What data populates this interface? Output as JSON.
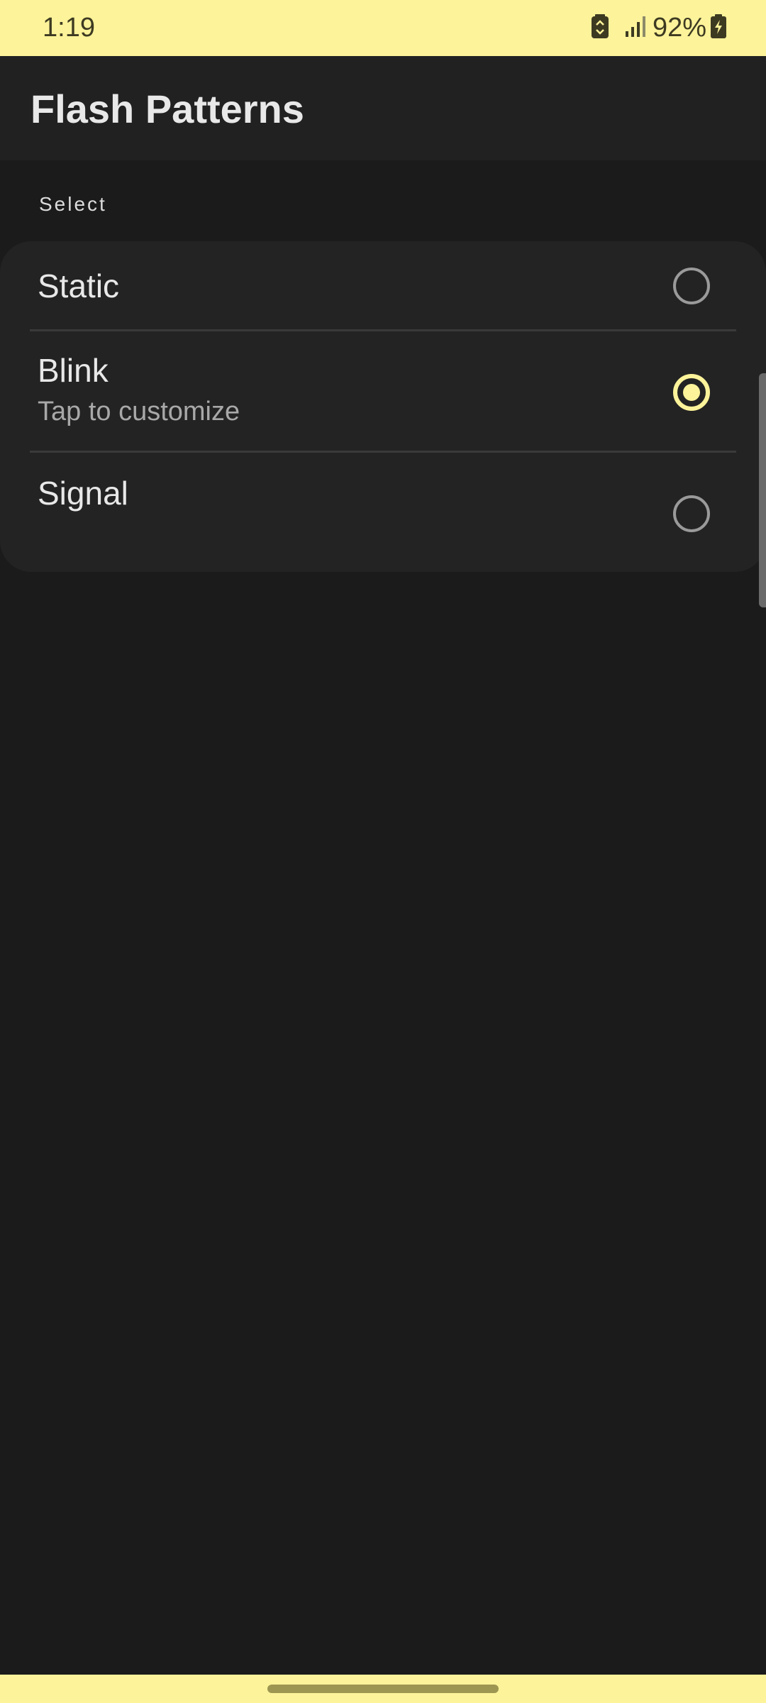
{
  "status_bar": {
    "time": "1:19",
    "battery_percent": "92%",
    "icons": [
      "battery-saver-icon",
      "cell-signal-icon",
      "battery-charging-icon"
    ],
    "background_color": "#fdf39a"
  },
  "app_bar": {
    "title": "Flash Patterns"
  },
  "section": {
    "header": "Select"
  },
  "options": [
    {
      "title": "Static",
      "subtitle": "",
      "selected": false
    },
    {
      "title": "Blink",
      "subtitle": "Tap to customize",
      "selected": true
    },
    {
      "title": "Signal",
      "subtitle": "",
      "selected": false
    }
  ],
  "colors": {
    "accent": "#fdf39a",
    "background": "#1b1b1b",
    "card": "#232323"
  }
}
